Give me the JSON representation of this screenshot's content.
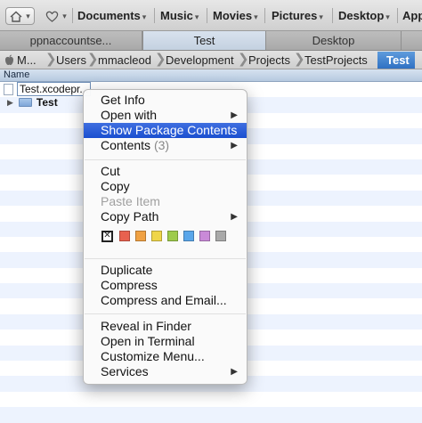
{
  "favorites": {
    "items": [
      {
        "label": "Documents",
        "caret": "▾"
      },
      {
        "label": "Music",
        "caret": "▾"
      },
      {
        "label": "Movies",
        "caret": "▾"
      },
      {
        "label": "Pictures",
        "caret": "▾"
      },
      {
        "label": "Desktop",
        "caret": "▾"
      },
      {
        "label": "App",
        "caret": ""
      }
    ]
  },
  "tabs": [
    {
      "label": "ppnaccountse..."
    },
    {
      "label": "Test"
    },
    {
      "label": "Desktop"
    }
  ],
  "path": {
    "items": [
      {
        "label": "M..."
      },
      {
        "label": "Users"
      },
      {
        "label": "mmacleod"
      },
      {
        "label": "Development"
      },
      {
        "label": "Projects"
      },
      {
        "label": "TestProjects"
      },
      {
        "label": "Test"
      }
    ]
  },
  "list": {
    "column_name": "Name",
    "files": [
      {
        "name": "Test.xcodeproj",
        "visible_name": "Test.xcodepr..."
      },
      {
        "name": "Test"
      }
    ]
  },
  "menu": {
    "get_info": "Get Info",
    "open_with": "Open with",
    "show_package_contents": "Show Package Contents",
    "contents": "Contents",
    "contents_count": "(3)",
    "cut": "Cut",
    "copy": "Copy",
    "paste_item": "Paste Item",
    "copy_path": "Copy Path",
    "duplicate": "Duplicate",
    "compress": "Compress",
    "compress_email": "Compress and Email...",
    "reveal_in_finder": "Reveal in Finder",
    "open_in_terminal": "Open in Terminal",
    "customize_menu": "Customize Menu...",
    "services": "Services",
    "submenu_arrow": "▶",
    "label_none": "✕",
    "label_colors": [
      "#e8614f",
      "#f0a143",
      "#efd64a",
      "#9ecb4b",
      "#5aa6ea",
      "#c98ad8",
      "#a9a9a9"
    ]
  },
  "colors": {
    "highlight": "#2453d6",
    "row_stripe": "#edf3fe"
  }
}
